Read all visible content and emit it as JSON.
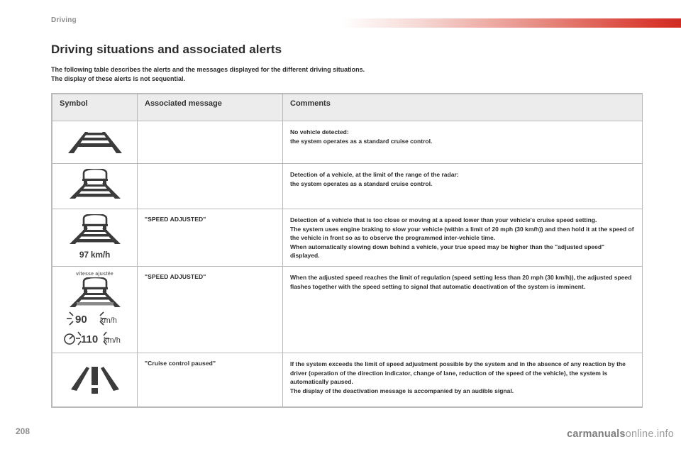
{
  "header": {
    "chapter": "Driving",
    "accent_color": "#d8392f"
  },
  "title": "Driving situations and associated alerts",
  "intro": [
    "The following table describes the alerts and the messages displayed for the different driving situations.",
    "The display of these alerts is not sequential."
  ],
  "table": {
    "columns": [
      "Symbol",
      "Associated message",
      "Comments"
    ],
    "rows": [
      {
        "symbol": {
          "type": "road",
          "caption": "",
          "speeds": []
        },
        "message": "",
        "comments": [
          "No vehicle detected:",
          "the system operates as a standard cruise control."
        ]
      },
      {
        "symbol": {
          "type": "car-road",
          "caption": "",
          "speeds": []
        },
        "message": "",
        "comments": [
          "Detection of a vehicle, at the limit of the range of the radar:",
          "the system operates as a standard cruise control."
        ]
      },
      {
        "symbol": {
          "type": "car-road-speed",
          "caption": "",
          "speeds": [
            "97 km/h"
          ]
        },
        "message": "\"SPEED ADJUSTED\"",
        "comments": [
          "Detection of a vehicle that is too close or moving at a speed lower than your vehicle's cruise speed setting.",
          "The system uses engine braking to slow your vehicle (within a limit of 20 mph (30 km/h)) and then hold it at the speed of the vehicle in front so as to observe the programmed inter-vehicle time.",
          "When automatically slowing down behind a vehicle, your true speed may be higher than the \"adjusted speed\" displayed."
        ]
      },
      {
        "symbol": {
          "type": "car-road-flashing",
          "caption": "vitesse ajustée",
          "speeds": [
            "90 km/h",
            "110 km/h"
          ]
        },
        "message": "\"SPEED ADJUSTED\"",
        "comments": [
          "When the adjusted speed reaches the limit of regulation (speed setting less than 20 mph (30 km/h)), the adjusted speed flashes together with the speed setting to signal that automatic deactivation of the system is imminent."
        ]
      },
      {
        "symbol": {
          "type": "warning",
          "caption": "",
          "speeds": []
        },
        "message": "\"Cruise control paused\"",
        "comments": [
          "If the system exceeds the limit of speed adjustment possible by the system and in the absence of any reaction by the driver (operation of the direction indicator, change of lane, reduction of the speed of the vehicle), the system is automatically paused.",
          "The display of the deactivation message is accompanied by an audible signal."
        ]
      }
    ]
  },
  "footer": {
    "page_number": "208",
    "watermark_prefix": "carmanuals",
    "watermark_suffix": "online.info"
  }
}
